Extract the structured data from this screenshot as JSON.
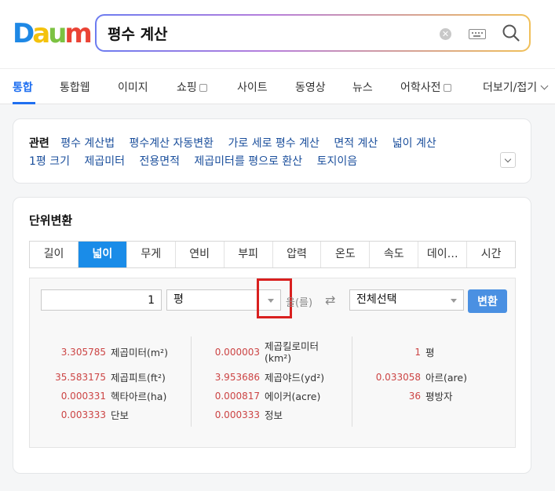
{
  "header": {
    "logo": {
      "letters": [
        "D",
        "a",
        "u",
        "m"
      ],
      "colors": [
        "#1e88e5",
        "#f4c20d",
        "#7cc242",
        "#ea4335"
      ]
    },
    "search": {
      "value": "평수 계산"
    }
  },
  "tabs": [
    {
      "label": "통합",
      "active": true
    },
    {
      "label": "통합웹"
    },
    {
      "label": "이미지"
    },
    {
      "label": "쇼핑"
    },
    {
      "label": "사이트"
    },
    {
      "label": "동영상"
    },
    {
      "label": "뉴스"
    },
    {
      "label": "어학사전"
    },
    {
      "label": "더보기/접기"
    }
  ],
  "related": {
    "title": "관련",
    "row1": [
      "평수 계산법",
      "평수계산 자동변환",
      "가로 세로 평수 계산",
      "면적 계산",
      "넓이 계산"
    ],
    "row2": [
      "1평 크기",
      "제곱미터",
      "전용면적",
      "제곱미터를 평으로 환산",
      "토지이음"
    ]
  },
  "converter": {
    "title": "단위변환",
    "unit_tabs": [
      "길이",
      "넓이",
      "무게",
      "연비",
      "부피",
      "압력",
      "온도",
      "속도",
      "데이…",
      "시간"
    ],
    "active_tab": "넓이",
    "amount": "1",
    "from_unit": "평",
    "eul_label": "을(를)",
    "to_unit": "전체선택",
    "convert_label": "변환",
    "results": {
      "col1": [
        {
          "value": "3.305785",
          "unit": "제곱미터(m²)"
        },
        {
          "value": "35.583175",
          "unit": "제곱피트(ft²)"
        },
        {
          "value": "0.000331",
          "unit": "헥타아르(ha)"
        },
        {
          "value": "0.003333",
          "unit": "단보"
        }
      ],
      "col2": [
        {
          "value": "0.000003",
          "unit": "제곱킬로미터",
          "unit2": "(km²)"
        },
        {
          "value": "3.953686",
          "unit": "제곱야드(yd²)"
        },
        {
          "value": "0.000817",
          "unit": "에이커(acre)"
        },
        {
          "value": "0.000333",
          "unit": "정보"
        }
      ],
      "col3": [
        {
          "value": "1",
          "unit": "평"
        },
        {
          "value": "0.033058",
          "unit": "아르(are)"
        },
        {
          "value": "36",
          "unit": "평방자"
        }
      ]
    }
  }
}
